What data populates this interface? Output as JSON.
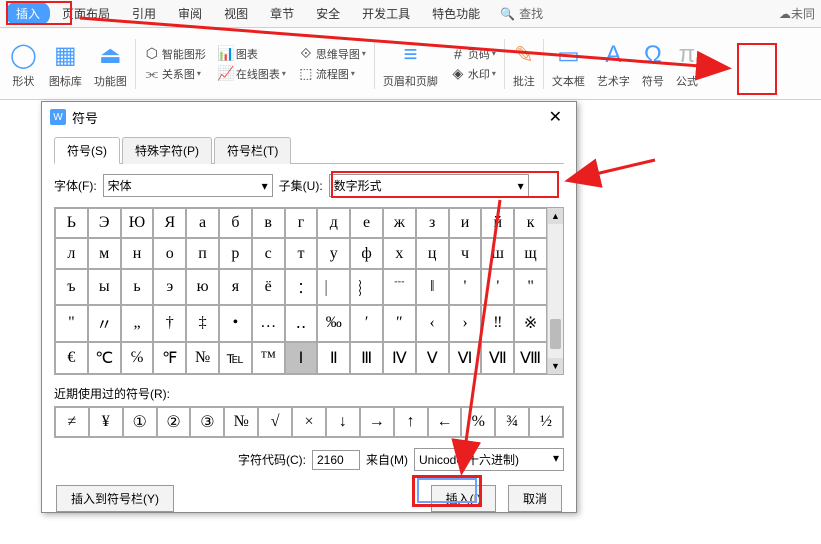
{
  "menubar": {
    "items": [
      "插入",
      "页面布局",
      "引用",
      "审阅",
      "视图",
      "章节",
      "安全",
      "开发工具",
      "特色功能"
    ],
    "search_label": "查找",
    "unsync_label": "未同"
  },
  "ribbon": {
    "shape": "形状",
    "iconlib": "图标库",
    "funcimg": "功能图",
    "smart": "智能图形",
    "relation": "关系图",
    "chart": "图表",
    "onlinechart": "在线图表",
    "mindmap": "思维导图",
    "flowchart": "流程图",
    "headerfooter": "页眉和页脚",
    "pagenum": "页码",
    "watermark": "水印",
    "annotate": "批注",
    "textbox": "文本框",
    "wordart": "艺术字",
    "symbol": "符号",
    "formula": "公式"
  },
  "dialog": {
    "title": "符号",
    "tabs": [
      "符号(S)",
      "特殊字符(P)",
      "符号栏(T)"
    ],
    "font_label": "字体(F):",
    "font_value": "宋体",
    "subset_label": "子集(U):",
    "subset_value": "数字形式",
    "grid": [
      "Ь",
      "Э",
      "Ю",
      "Я",
      "а",
      "б",
      "в",
      "г",
      "д",
      "е",
      "ж",
      "з",
      "и",
      "й",
      "к",
      "л",
      "м",
      "н",
      "о",
      "п",
      "р",
      "с",
      "т",
      "у",
      "ф",
      "х",
      "ц",
      "ч",
      "ш",
      "щ",
      "ъ",
      "ы",
      "ь",
      "э",
      "ю",
      "я",
      "ё",
      "︰",
      "︳",
      "︴",
      "﹉",
      "‖",
      "'",
      "'",
      "\"",
      "\"",
      "〃",
      "„",
      "†",
      "‡",
      "•",
      "…",
      "‥",
      "‰",
      "′",
      "″",
      "‹",
      "›",
      "‼",
      "※",
      "€",
      "℃",
      "℅",
      "℉",
      "№",
      "℡",
      "™",
      "Ⅰ",
      "Ⅱ",
      "Ⅲ",
      "Ⅳ",
      "Ⅴ",
      "Ⅵ",
      "Ⅶ",
      "Ⅷ"
    ],
    "selected_index": 67,
    "recent_label": "近期使用过的符号(R):",
    "recent": [
      "≠",
      "¥",
      "①",
      "②",
      "③",
      "№",
      "√",
      "×",
      "↓",
      "→",
      "↑",
      "←",
      "%",
      "¾",
      "½"
    ],
    "code_label": "字符代码(C):",
    "code_value": "2160",
    "from_label": "来自(M)",
    "from_value": "Unicode(十六进制)",
    "btn_insert_bar": "插入到符号栏(Y)",
    "btn_insert": "插入(I)",
    "btn_cancel": "取消"
  }
}
